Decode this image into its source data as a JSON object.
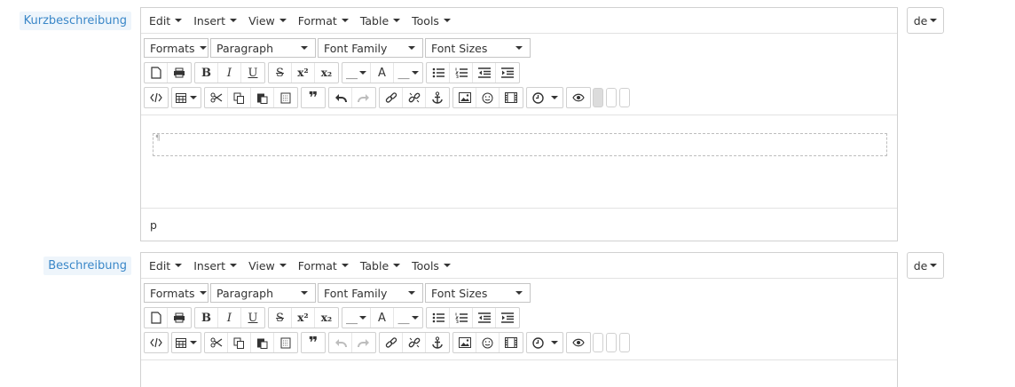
{
  "fields": [
    {
      "label": "Kurzbeschreibung",
      "menu": [
        "Edit",
        "Insert",
        "View",
        "Format",
        "Table",
        "Tools"
      ],
      "selects": {
        "formats": "Formats",
        "block": "Paragraph",
        "font_family": "Font Family",
        "font_sizes": "Font Sizes"
      },
      "status_path": "p",
      "lang": "de"
    },
    {
      "label": "Beschreibung",
      "menu": [
        "Edit",
        "Insert",
        "View",
        "Format",
        "Table",
        "Tools"
      ],
      "selects": {
        "formats": "Formats",
        "block": "Paragraph",
        "font_family": "Font Family",
        "font_sizes": "Font Sizes"
      },
      "lang": "de"
    }
  ],
  "glyphs": {
    "bold": "B",
    "italic": "I",
    "underline": "U",
    "strike": "S",
    "sup": "x²",
    "sub": "x₂",
    "text_color": "A",
    "blank": "__",
    "blockquote": "❞"
  }
}
